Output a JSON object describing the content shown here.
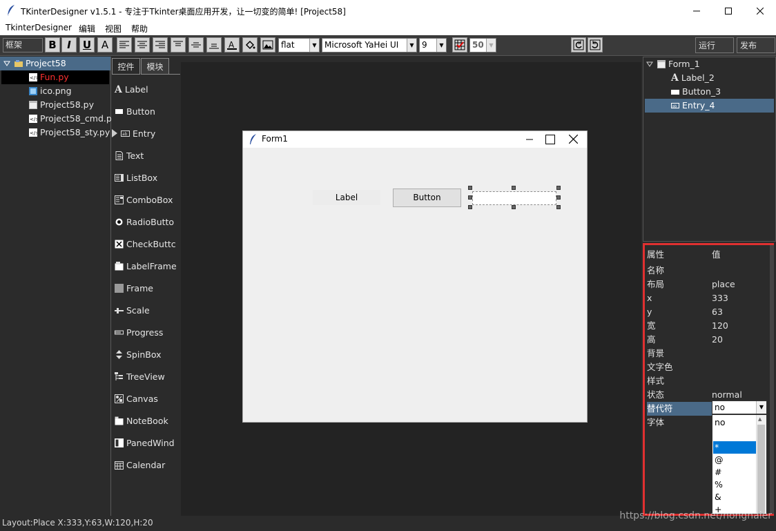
{
  "window": {
    "title": "TKinterDesigner v1.5.1 - 专注于Tkinter桌面应用开发，让一切变的简单!    [Project58]"
  },
  "menu": [
    "TkinterDesigner",
    "编辑",
    "视图",
    "帮助"
  ],
  "toolbar": {
    "frame_combo": "框架",
    "format_buttons": [
      "B",
      "I",
      "U",
      "A"
    ],
    "relief_value": "flat",
    "font_value": "Microsoft YaHei UI",
    "size_value": "9",
    "zoom_value": "50",
    "run_label": "运行",
    "publish_label": "发布"
  },
  "project": {
    "root": "Project58",
    "files": [
      {
        "name": "Fun.py",
        "selected": true
      },
      {
        "name": "ico.png",
        "selected": false
      },
      {
        "name": "Project58.py",
        "selected": false
      },
      {
        "name": "Project58_cmd.py",
        "selected": false
      },
      {
        "name": "Project58_sty.py",
        "selected": false
      }
    ]
  },
  "palette": {
    "tabs": [
      "控件",
      "模块"
    ],
    "items": [
      "Label",
      "Button",
      "Entry",
      "Text",
      "ListBox",
      "ComboBox",
      "RadioButto",
      "CheckButtc",
      "LabelFrame",
      "Frame",
      "Scale",
      "Progress",
      "SpinBox",
      "TreeView",
      "Canvas",
      "NoteBook",
      "PanedWind",
      "Calendar"
    ]
  },
  "form": {
    "title": "Form1",
    "label_text": "Label",
    "button_text": "Button"
  },
  "widget_tree": {
    "root": "Form_1",
    "children": [
      "Label_2",
      "Button_3",
      "Entry_4"
    ],
    "selected": "Entry_4"
  },
  "properties": {
    "header_name": "属性",
    "header_value": "值",
    "rows": [
      {
        "name": "名称",
        "value": ""
      },
      {
        "name": "布局",
        "value": "place"
      },
      {
        "name": "x",
        "value": "333"
      },
      {
        "name": "y",
        "value": "63"
      },
      {
        "name": "宽",
        "value": "120"
      },
      {
        "name": "高",
        "value": "20"
      },
      {
        "name": "背景",
        "value": ""
      },
      {
        "name": "文字色",
        "value": ""
      },
      {
        "name": "样式",
        "value": ""
      },
      {
        "name": "状态",
        "value": "normal"
      },
      {
        "name": "替代符",
        "value": ""
      },
      {
        "name": "字体",
        "value": ""
      }
    ],
    "dropdown_value": "no",
    "dropdown_options": [
      "no",
      "",
      "*",
      "@",
      "#",
      "%",
      "&",
      "+"
    ],
    "dropdown_selected": "*"
  },
  "status": {
    "text": "Layout:Place  X:333,Y:63,W:120,H:20"
  },
  "watermark": "https://blog.csdn.net/honghaier",
  "colors": {
    "accent": "#0078d7",
    "selection": "#4a6a88",
    "highlight_border": "#e03030",
    "selected_file": "#ff3030"
  }
}
